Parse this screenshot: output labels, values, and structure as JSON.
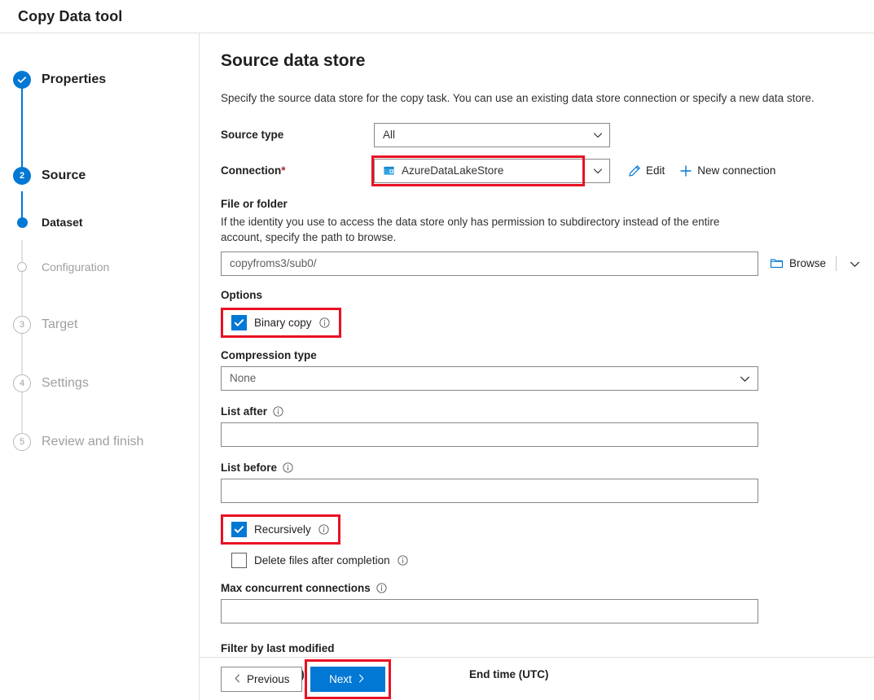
{
  "window": {
    "title": "Copy Data tool"
  },
  "wizard": {
    "steps": [
      {
        "id": "properties",
        "label": "Properties",
        "state": "done",
        "marker": "check"
      },
      {
        "id": "source",
        "label": "Source",
        "state": "current",
        "marker": "2"
      },
      {
        "id": "dataset",
        "label": "Dataset",
        "state": "active-sub",
        "marker": "dot"
      },
      {
        "id": "configuration",
        "label": "Configuration",
        "state": "pending-sub",
        "marker": "hollow"
      },
      {
        "id": "target",
        "label": "Target",
        "state": "pending",
        "marker": "3"
      },
      {
        "id": "settings",
        "label": "Settings",
        "state": "pending",
        "marker": "4"
      },
      {
        "id": "review",
        "label": "Review and finish",
        "state": "pending",
        "marker": "5"
      }
    ]
  },
  "page": {
    "title": "Source data store",
    "description": "Specify the source data store for the copy task. You can use an existing data store connection or specify a new data store."
  },
  "form": {
    "source_type": {
      "label": "Source type",
      "value": "All"
    },
    "connection": {
      "label": "Connection",
      "required_marker": "*",
      "value": "AzureDataLakeStore",
      "icon": "azure-data-lake-store-icon",
      "edit_label": "Edit",
      "new_connection_label": "New connection"
    },
    "file_or_folder": {
      "label": "File or folder",
      "help": "If the identity you use to access the data store only has permission to subdirectory instead of the entire account, specify the path to browse.",
      "value": "copyfroms3/sub0/",
      "browse_label": "Browse"
    },
    "options_label": "Options",
    "binary_copy": {
      "label": "Binary copy",
      "checked": true
    },
    "compression_type": {
      "label": "Compression type",
      "value": "None"
    },
    "list_after": {
      "label": "List after",
      "value": ""
    },
    "list_before": {
      "label": "List before",
      "value": ""
    },
    "recursively": {
      "label": "Recursively",
      "checked": true
    },
    "delete_files_after_completion": {
      "label": "Delete files after completion",
      "checked": false
    },
    "max_concurrent_connections": {
      "label": "Max concurrent connections",
      "value": ""
    },
    "filter_by_last_modified": {
      "label": "Filter by last modified",
      "start_time_label": "Start time (UTC)",
      "end_time_label": "End time (UTC)"
    }
  },
  "footer": {
    "previous_label": "Previous",
    "next_label": "Next"
  },
  "colors": {
    "accent": "#0078d4",
    "highlight": "#e81123",
    "required": "#a4262c",
    "muted_text": "#a19f9d"
  }
}
